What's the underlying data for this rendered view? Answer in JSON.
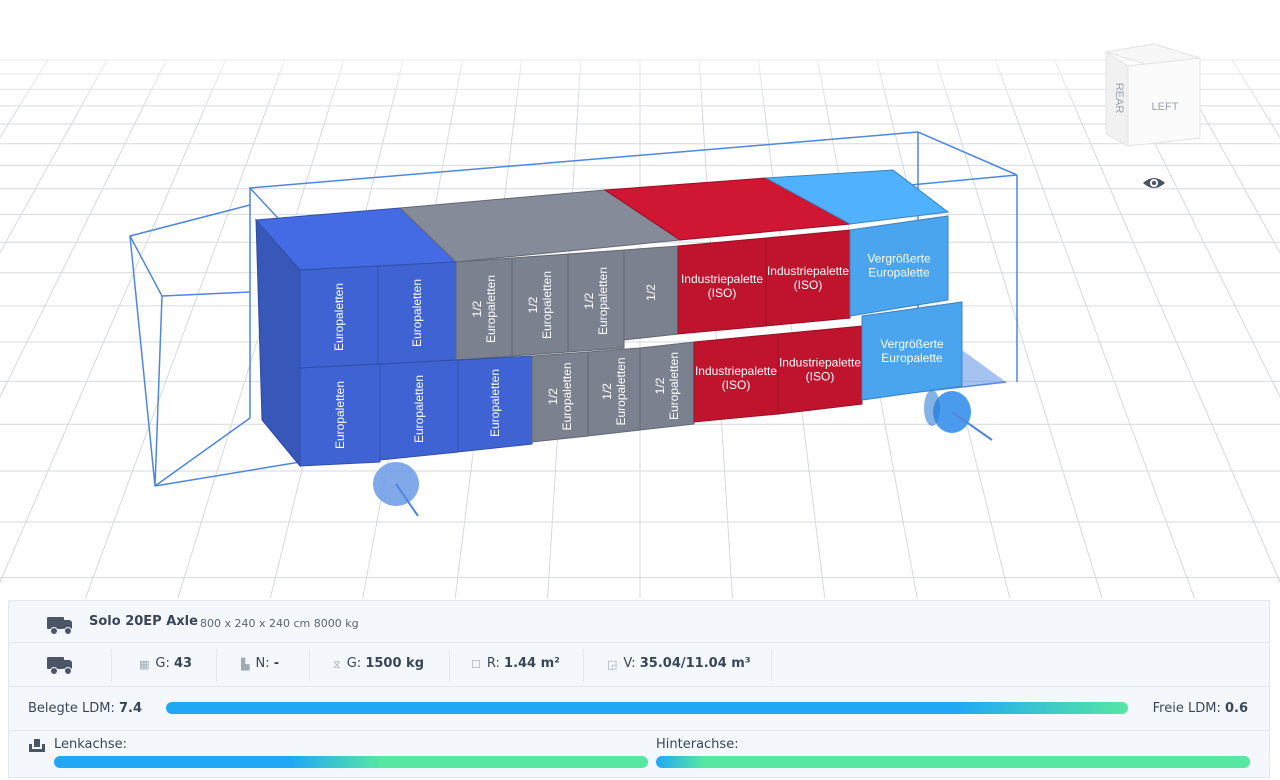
{
  "scene": {
    "view_cube": {
      "face_front": "LEFT",
      "face_side": "REAR"
    },
    "pallet_labels": {
      "euro": "Europaletten",
      "half_prefix": "1/2",
      "half_name": "Europaletten",
      "industrie_line1": "Industriepalette",
      "industrie_line2": "(ISO)",
      "vergr_line1": "Vergrößerte",
      "vergr_line2": "Europalette"
    },
    "colors": {
      "euro": "#3f63d2",
      "half": "#7c818f",
      "industrie": "#c0142e",
      "vergr": "#4aa4ee",
      "wire": "#4f86e0"
    },
    "visibility_icon": "eye-icon"
  },
  "vehicle": {
    "name": "Solo 20EP Axle",
    "dims": "800 x 240 x 240 cm 8000 kg"
  },
  "stats": {
    "g_label": "G:",
    "g_value": "43",
    "n_label": "N:",
    "n_value": "-",
    "weight_label": "G:",
    "weight_value": "1500 kg",
    "r_label": "R:",
    "r_value": "1.44 m²",
    "v_label": "V:",
    "v_value": "35.04/11.04 m³"
  },
  "ldm": {
    "used_label": "Belegte LDM:",
    "used_value": "7.4",
    "free_label": "Freie LDM:",
    "free_value": "0.6",
    "used_fraction": 0.925
  },
  "axles": {
    "front_label": "Lenkachse:",
    "rear_label": "Hinterachse:"
  }
}
